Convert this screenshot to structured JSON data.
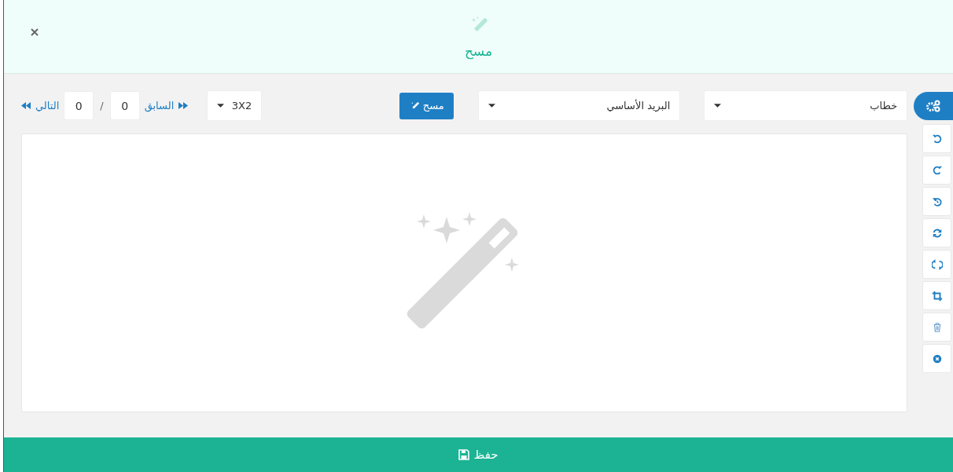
{
  "header": {
    "title": "مسح"
  },
  "toolbar": {
    "pager": {
      "next_label": "التالي",
      "values": [
        "0",
        "0"
      ],
      "separator": "/",
      "previous_label": "السابق"
    },
    "layout_select": {
      "value": "3X2"
    },
    "scan_button": {
      "label": "مسح"
    },
    "selects": [
      {
        "value": "خطاب"
      },
      {
        "value": "البريد الأساسي"
      }
    ]
  },
  "save_button": {
    "label": "حفظ"
  }
}
